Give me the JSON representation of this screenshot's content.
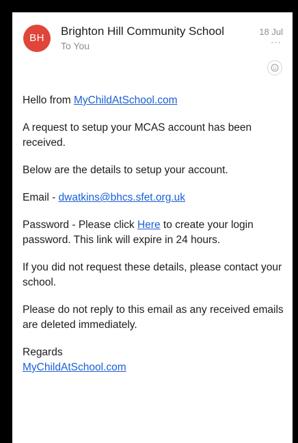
{
  "email": {
    "avatar_initials": "BH",
    "sender": "Brighton Hill Community School",
    "recipient": "To You",
    "date": "18 Jul",
    "more": "···",
    "emoji_icon": "smiley-reaction-icon"
  },
  "body": {
    "greeting_prefix": "Hello from ",
    "greeting_link": "MyChildAtSchool.com",
    "request_line": "A request to setup your MCAS account has been received.",
    "details_line": "Below are the details to setup your account.",
    "email_prefix": "Email - ",
    "email_link": "dwatkins@bhcs.sfet.org.uk",
    "password_prefix": "Password - Please click ",
    "password_link": "Here",
    "password_suffix": " to create your login password. This link will expire in 24 hours.",
    "contact_line": "If you did not request these details, please contact your school.",
    "noreply_line": "Please do not reply to this email as any received emails are deleted immediately.",
    "regards": "Regards",
    "signature_link": "MyChildAtSchool.com"
  },
  "colors": {
    "avatar": "#e0453a",
    "link": "#1a5fd6",
    "frame": "#000000"
  }
}
